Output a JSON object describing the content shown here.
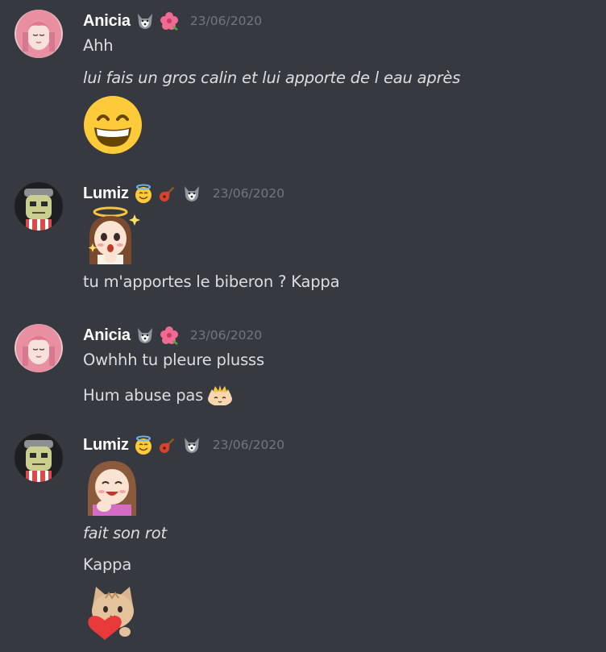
{
  "messages": [
    {
      "author": "Anicia",
      "timestamp": "23/06/2020",
      "badges": [
        "wolf-icon",
        "hibiscus-icon"
      ],
      "lines": [
        "Ahh",
        "lui fais un gros calin et lui apporte de l eau après"
      ],
      "emote": "grinning-face-emoji"
    },
    {
      "author": "Lumiz",
      "timestamp": "23/06/2020",
      "badges": [
        "halo-smile-icon",
        "guitar-icon",
        "wolf-icon"
      ],
      "emote": "angel-girl-emote",
      "lines": [
        "tu m'apportes le biberon ? Kappa"
      ]
    },
    {
      "author": "Anicia",
      "timestamp": "23/06/2020",
      "badges": [
        "wolf-icon",
        "hibiscus-icon"
      ],
      "lines": [
        "Owhhh tu pleure plusss",
        "Hum abuse pas"
      ],
      "inline_emote": "crowned-cat-emote"
    },
    {
      "author": "Lumiz",
      "timestamp": "23/06/2020",
      "badges": [
        "halo-smile-icon",
        "guitar-icon",
        "wolf-icon"
      ],
      "emote": "happy-girl-emote",
      "lines": [
        "fait son rot",
        "Kappa"
      ],
      "emote_2": "cat-heart-emote"
    }
  ],
  "colors": {
    "background": "#36393f",
    "username": "#ffffff",
    "timestamp": "#72767d",
    "text": "#dcddde"
  }
}
